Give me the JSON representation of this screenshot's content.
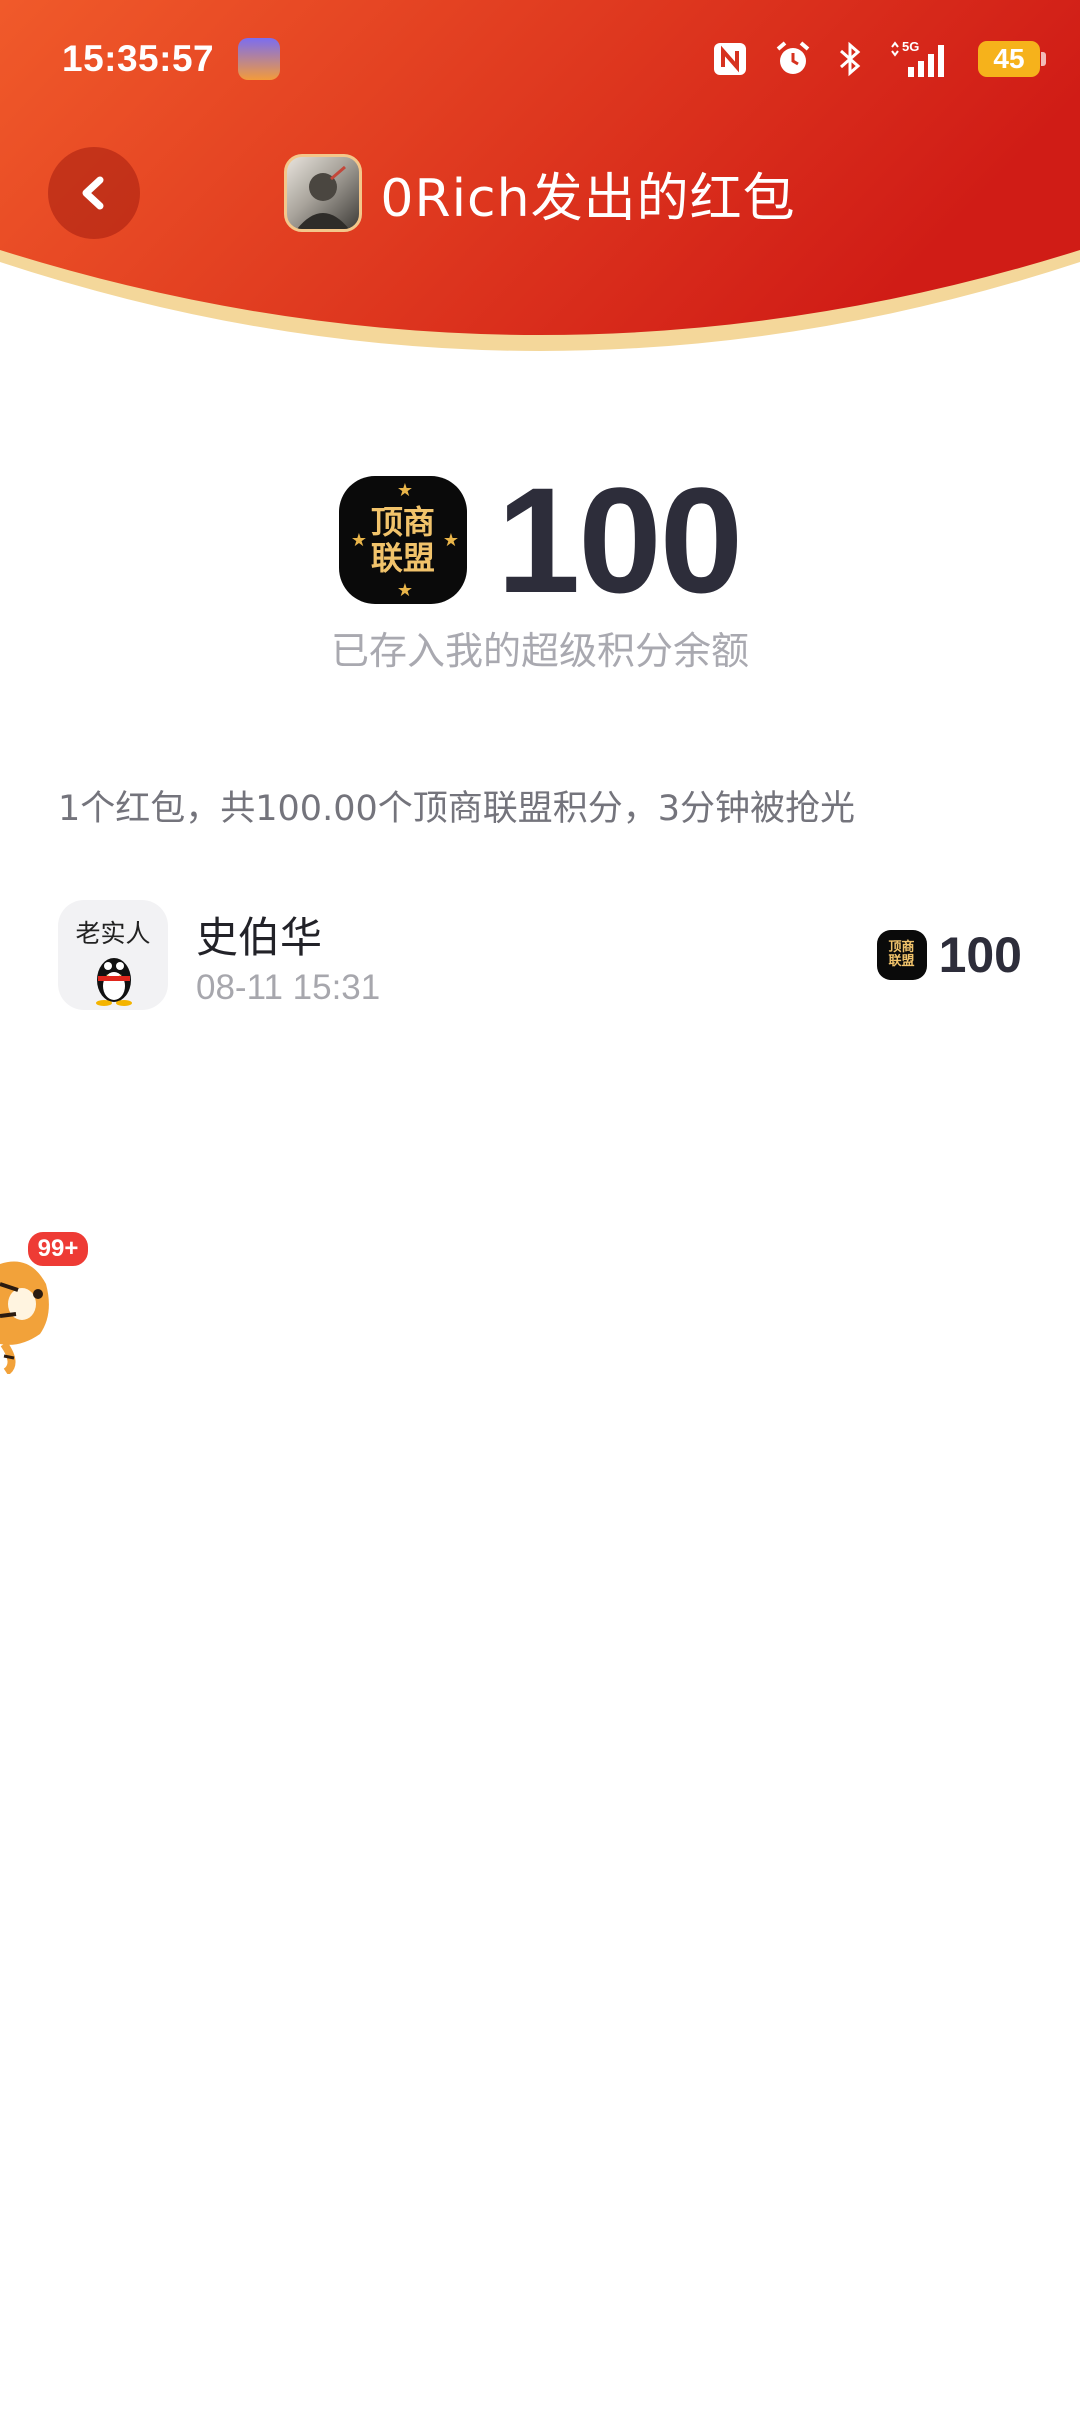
{
  "status_bar": {
    "time": "15:35:57",
    "battery": "45",
    "network": "5G",
    "icons": [
      "nfc-icon",
      "alarm-icon",
      "bluetooth-icon",
      "signal-icon",
      "battery-icon"
    ]
  },
  "header": {
    "back_icon": "chevron-left-icon",
    "title": "0Rich发出的红包",
    "colors": {
      "red_start": "#f05a2a",
      "red_end": "#d42018",
      "arc_edge": "#f4d79a"
    }
  },
  "amount": {
    "coin_label": "顶商联盟",
    "value": "100",
    "caption": "已存入我的超级积分余额"
  },
  "summary": "1个红包，共100.00个顶商联盟积分，3分钟被抢光",
  "records": [
    {
      "avatar_label": "老实人",
      "name": "史伯华",
      "time": "08-11 15:31",
      "coin_label": "顶商联盟",
      "amount": "100"
    }
  ],
  "floating": {
    "badge": "99+"
  }
}
